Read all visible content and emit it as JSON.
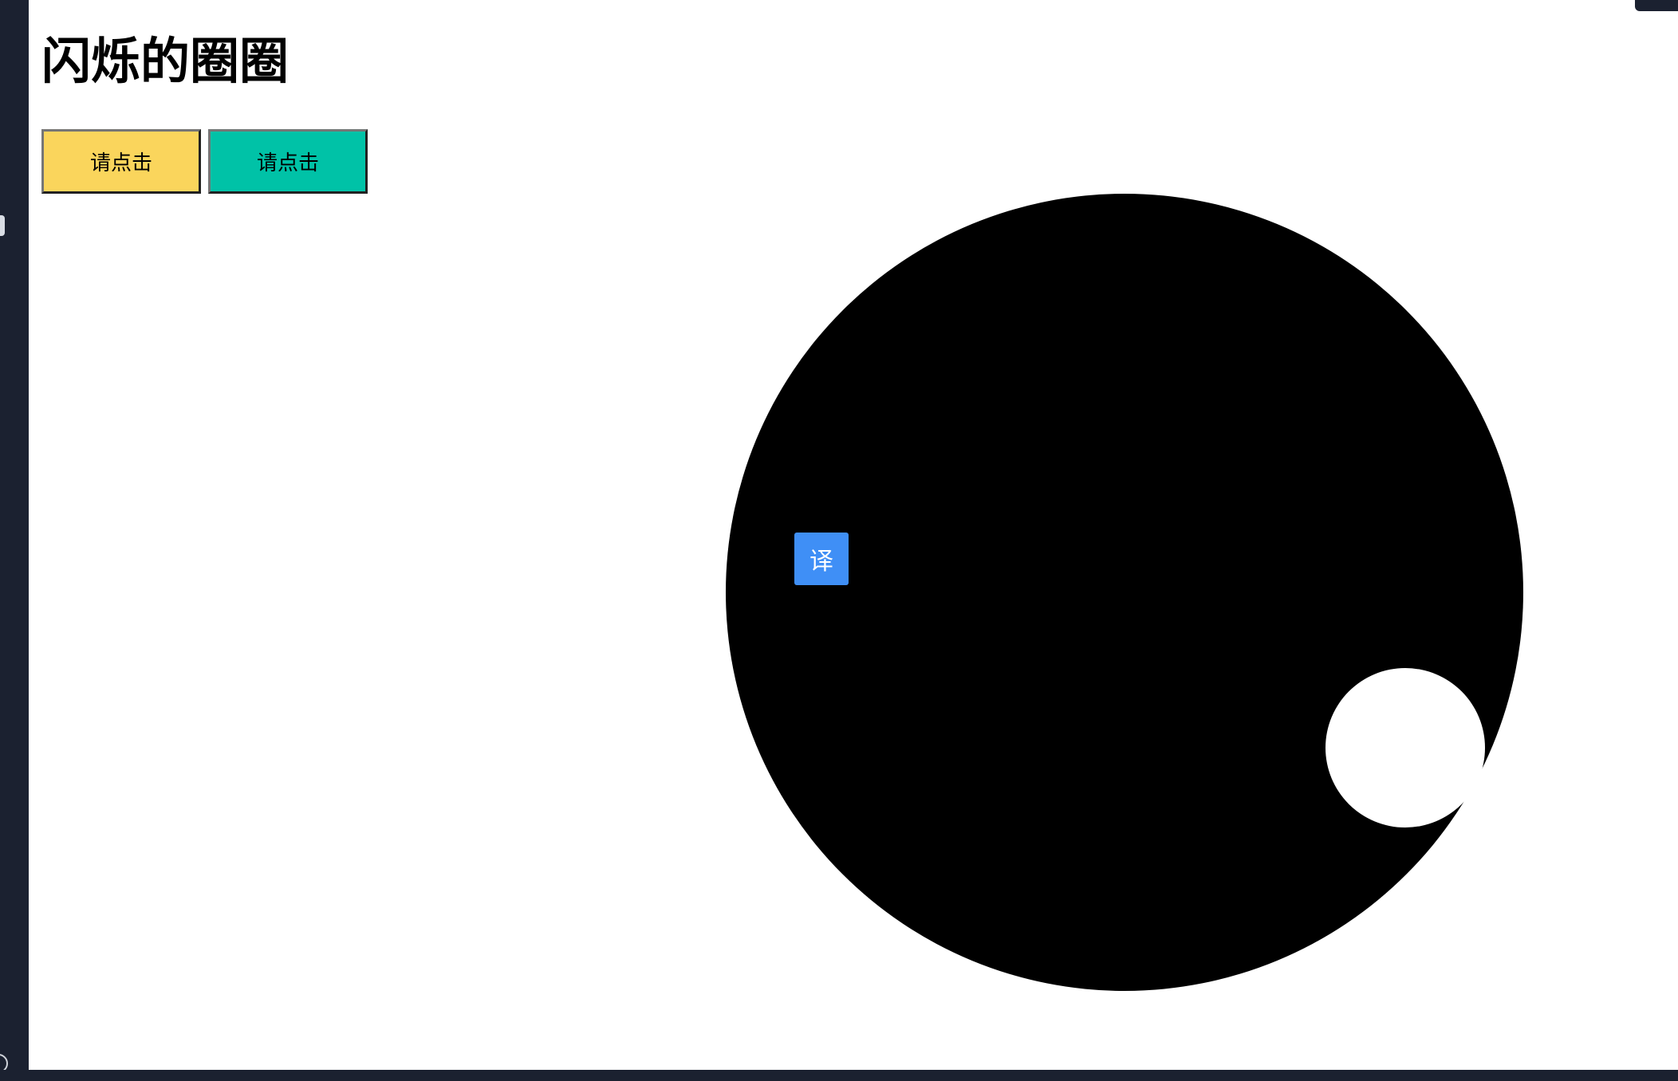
{
  "page": {
    "title": "闪烁的圈圈"
  },
  "buttons": [
    {
      "label": "请点击",
      "color": "#fad55c"
    },
    {
      "label": "请点击",
      "color": "#00c2a7"
    }
  ],
  "translate": {
    "label": "译",
    "color": "#3f8ff6"
  },
  "circles": {
    "outer_color": "#000000",
    "inner_color": "#ffffff"
  }
}
